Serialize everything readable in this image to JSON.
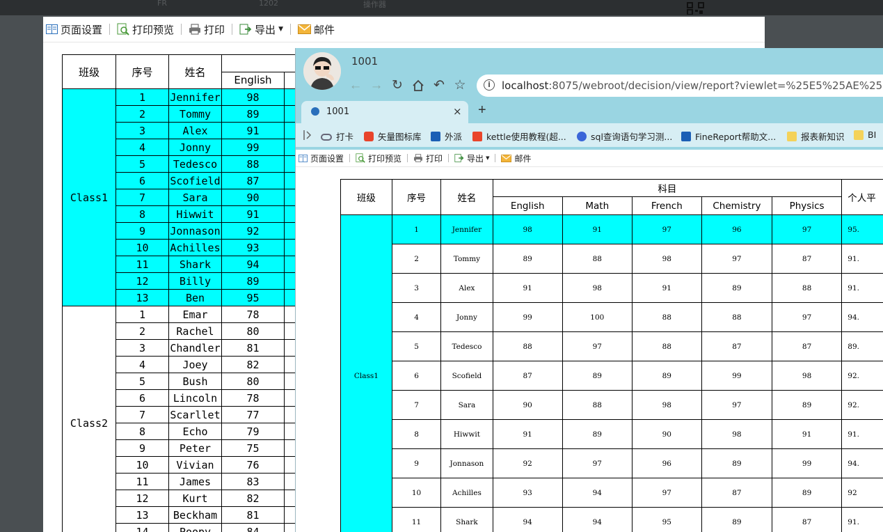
{
  "toolbar": {
    "page_setup": "页面设置",
    "print_preview": "打印预览",
    "print": "打印",
    "export": "导出",
    "mail": "邮件"
  },
  "bg_ghost": [
    "FR",
    "1202",
    "操作器"
  ],
  "back_report": {
    "headers": {
      "class": "班级",
      "seq": "序号",
      "name": "姓名",
      "english": "English"
    },
    "groups": [
      {
        "class": "Class1",
        "rows": [
          [
            "1",
            "Jennifer",
            "98"
          ],
          [
            "2",
            "Tommy",
            "89"
          ],
          [
            "3",
            "Alex",
            "91"
          ],
          [
            "4",
            "Jonny",
            "99"
          ],
          [
            "5",
            "Tedesco",
            "88"
          ],
          [
            "6",
            "Scofield",
            "87"
          ],
          [
            "7",
            "Sara",
            "90"
          ],
          [
            "8",
            "Hiwwit",
            "91"
          ],
          [
            "9",
            "Jonnason",
            "92"
          ],
          [
            "10",
            "Achilles",
            "93"
          ],
          [
            "11",
            "Shark",
            "94"
          ],
          [
            "12",
            "Billy",
            "89"
          ],
          [
            "13",
            "Ben",
            "95"
          ]
        ]
      },
      {
        "class": "Class2",
        "rows": [
          [
            "1",
            "Emar",
            "78"
          ],
          [
            "2",
            "Rachel",
            "80"
          ],
          [
            "3",
            "Chandler",
            "81"
          ],
          [
            "4",
            "Joey",
            "82"
          ],
          [
            "5",
            "Bush",
            "80"
          ],
          [
            "6",
            "Lincoln",
            "78"
          ],
          [
            "7",
            "Scarllet",
            "77"
          ],
          [
            "8",
            "Echo",
            "79"
          ],
          [
            "9",
            "Peter",
            "75"
          ],
          [
            "10",
            "Vivian",
            "76"
          ],
          [
            "11",
            "James",
            "83"
          ],
          [
            "12",
            "Kurt",
            "82"
          ],
          [
            "13",
            "Beckham",
            "81"
          ],
          [
            "14",
            "Poopy",
            "84"
          ]
        ]
      }
    ]
  },
  "browser": {
    "window_title": "1001",
    "url_host": "localhost",
    "url_rest": ":8075/webroot/decision/view/report?viewlet=%25E5%25AE%258B%25E9",
    "tab_title": "1001",
    "tab_close": "×",
    "new_tab": "+",
    "bookmarks": [
      "打卡",
      "矢量图标库",
      "外派",
      "kettle使用教程(超...",
      "sql查询语句学习测...",
      "FineReport帮助文...",
      "报表新知识",
      "BI"
    ],
    "colors": {
      "frame": "#9ad5e2",
      "tab": "#d7eef4",
      "highlight": "#00ffff"
    }
  },
  "front_report": {
    "headers": {
      "class": "班级",
      "seq": "序号",
      "name": "姓名",
      "subject": "科目",
      "avg": "个人平",
      "subjects": [
        "English",
        "Math",
        "French",
        "Chemistry",
        "Physics"
      ]
    },
    "class": "Class1",
    "rows": [
      {
        "seq": "1",
        "name": "Jennifer",
        "scores": [
          "98",
          "91",
          "97",
          "96",
          "97"
        ],
        "avg": "95."
      },
      {
        "seq": "2",
        "name": "Tommy",
        "scores": [
          "89",
          "88",
          "98",
          "97",
          "87"
        ],
        "avg": "91."
      },
      {
        "seq": "3",
        "name": "Alex",
        "scores": [
          "91",
          "98",
          "91",
          "89",
          "88"
        ],
        "avg": "91."
      },
      {
        "seq": "4",
        "name": "Jonny",
        "scores": [
          "99",
          "100",
          "88",
          "88",
          "97"
        ],
        "avg": "94."
      },
      {
        "seq": "5",
        "name": "Tedesco",
        "scores": [
          "88",
          "97",
          "88",
          "87",
          "87"
        ],
        "avg": "89."
      },
      {
        "seq": "6",
        "name": "Scofield",
        "scores": [
          "87",
          "89",
          "89",
          "99",
          "98"
        ],
        "avg": "92."
      },
      {
        "seq": "7",
        "name": "Sara",
        "scores": [
          "90",
          "88",
          "98",
          "97",
          "89"
        ],
        "avg": "92."
      },
      {
        "seq": "8",
        "name": "Hiwwit",
        "scores": [
          "91",
          "89",
          "90",
          "98",
          "91"
        ],
        "avg": "91."
      },
      {
        "seq": "9",
        "name": "Jonnason",
        "scores": [
          "92",
          "97",
          "96",
          "89",
          "99"
        ],
        "avg": "94."
      },
      {
        "seq": "10",
        "name": "Achilles",
        "scores": [
          "93",
          "94",
          "97",
          "87",
          "89"
        ],
        "avg": "92"
      },
      {
        "seq": "11",
        "name": "Shark",
        "scores": [
          "94",
          "94",
          "95",
          "89",
          "87"
        ],
        "avg": "91."
      }
    ]
  }
}
